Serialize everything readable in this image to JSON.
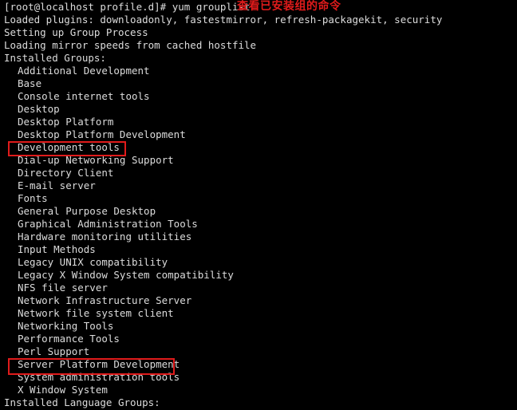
{
  "terminal": {
    "title": "yum grouplist output",
    "background_color": "#000000",
    "text_color": "#dcdcdc",
    "annotation_color": "#e01b1b",
    "prompt_line": "[root@localhost profile.d]# yum grouplist",
    "lines": [
      {
        "text": "[root@localhost profile.d]# yum grouplist",
        "indent": false
      },
      {
        "text": "Loaded plugins: downloadonly, fastestmirror, refresh-packagekit, security",
        "indent": false
      },
      {
        "text": "Setting up Group Process",
        "indent": false
      },
      {
        "text": "Loading mirror speeds from cached hostfile",
        "indent": false
      },
      {
        "text": "Installed Groups:",
        "indent": false
      },
      {
        "text": "Additional Development",
        "indent": true
      },
      {
        "text": "Base",
        "indent": true
      },
      {
        "text": "Console internet tools",
        "indent": true
      },
      {
        "text": "Desktop",
        "indent": true
      },
      {
        "text": "Desktop Platform",
        "indent": true
      },
      {
        "text": "Desktop Platform Development",
        "indent": true
      },
      {
        "text": "Development tools",
        "indent": true
      },
      {
        "text": "Dial-up Networking Support",
        "indent": true
      },
      {
        "text": "Directory Client",
        "indent": true
      },
      {
        "text": "E-mail server",
        "indent": true
      },
      {
        "text": "Fonts",
        "indent": true
      },
      {
        "text": "General Purpose Desktop",
        "indent": true
      },
      {
        "text": "Graphical Administration Tools",
        "indent": true
      },
      {
        "text": "Hardware monitoring utilities",
        "indent": true
      },
      {
        "text": "Input Methods",
        "indent": true
      },
      {
        "text": "Legacy UNIX compatibility",
        "indent": true
      },
      {
        "text": "Legacy X Window System compatibility",
        "indent": true
      },
      {
        "text": "NFS file server",
        "indent": true
      },
      {
        "text": "Network Infrastructure Server",
        "indent": true
      },
      {
        "text": "Network file system client",
        "indent": true
      },
      {
        "text": "Networking Tools",
        "indent": true
      },
      {
        "text": "Performance Tools",
        "indent": true
      },
      {
        "text": "Perl Support",
        "indent": true
      },
      {
        "text": "Server Platform Development",
        "indent": true
      },
      {
        "text": "System administration tools",
        "indent": true
      },
      {
        "text": "X Window System",
        "indent": true
      },
      {
        "text": "Installed Language Groups:",
        "indent": false
      }
    ],
    "annotation": {
      "text": "查看已安装组的命令"
    },
    "highlights": [
      {
        "label": "Development tools"
      },
      {
        "label": "Server Platform Development"
      }
    ]
  }
}
